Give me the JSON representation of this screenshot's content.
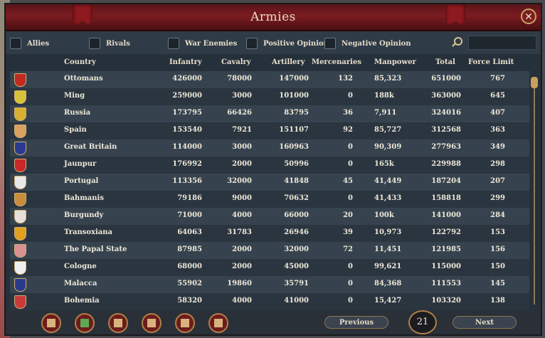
{
  "window": {
    "title": "Armies",
    "close_glyph": "✕"
  },
  "filters": [
    {
      "label": "Allies"
    },
    {
      "label": "Rivals"
    },
    {
      "label": "War Enemies"
    },
    {
      "label": "Positive Opinion"
    },
    {
      "label": "Negative Opinion"
    }
  ],
  "search": {
    "placeholder": ""
  },
  "columns": [
    "Country",
    "Infantry",
    "Cavalry",
    "Artillery",
    "Mercenaries",
    "Manpower",
    "Total",
    "Force Limit"
  ],
  "rows": [
    {
      "country": "Ottomans",
      "infantry": "426000",
      "cavalry": "78000",
      "artillery": "147000",
      "mercenaries": "132",
      "manpower": "85,323",
      "total": "651000",
      "force_limit": "767",
      "flag_color": "#c02a20"
    },
    {
      "country": "Ming",
      "infantry": "259000",
      "cavalry": "3000",
      "artillery": "101000",
      "mercenaries": "0",
      "manpower": "188k",
      "total": "363000",
      "force_limit": "645",
      "flag_color": "#d8c23a"
    },
    {
      "country": "Russia",
      "infantry": "173795",
      "cavalry": "66426",
      "artillery": "83795",
      "mercenaries": "36",
      "manpower": "7,911",
      "total": "324016",
      "force_limit": "407",
      "flag_color": "#d8b030"
    },
    {
      "country": "Spain",
      "infantry": "153540",
      "cavalry": "7921",
      "artillery": "151107",
      "mercenaries": "92",
      "manpower": "85,727",
      "total": "312568",
      "force_limit": "363",
      "flag_color": "#d9a060"
    },
    {
      "country": "Great Britain",
      "infantry": "114000",
      "cavalry": "3000",
      "artillery": "160963",
      "mercenaries": "0",
      "manpower": "90,309",
      "total": "277963",
      "force_limit": "349",
      "flag_color": "#2a3a90"
    },
    {
      "country": "Jaunpur",
      "infantry": "176992",
      "cavalry": "2000",
      "artillery": "50996",
      "mercenaries": "0",
      "manpower": "165k",
      "total": "229988",
      "force_limit": "298",
      "flag_color": "#c82828"
    },
    {
      "country": "Portugal",
      "infantry": "113356",
      "cavalry": "32000",
      "artillery": "41848",
      "mercenaries": "45",
      "manpower": "41,449",
      "total": "187204",
      "force_limit": "207",
      "flag_color": "#e8e8e8"
    },
    {
      "country": "Bahmanis",
      "infantry": "79186",
      "cavalry": "9000",
      "artillery": "70632",
      "mercenaries": "0",
      "manpower": "41,433",
      "total": "158818",
      "force_limit": "299",
      "flag_color": "#c88c3a"
    },
    {
      "country": "Burgundy",
      "infantry": "71000",
      "cavalry": "4000",
      "artillery": "66000",
      "mercenaries": "20",
      "manpower": "100k",
      "total": "141000",
      "force_limit": "284",
      "flag_color": "#e8e0d8"
    },
    {
      "country": "Transoxiana",
      "infantry": "64063",
      "cavalry": "31783",
      "artillery": "26946",
      "mercenaries": "39",
      "manpower": "10,973",
      "total": "122792",
      "force_limit": "153",
      "flag_color": "#e0a020"
    },
    {
      "country": "The Papal State",
      "infantry": "87985",
      "cavalry": "2000",
      "artillery": "32000",
      "mercenaries": "72",
      "manpower": "11,451",
      "total": "121985",
      "force_limit": "156",
      "flag_color": "#d89090"
    },
    {
      "country": "Cologne",
      "infantry": "68000",
      "cavalry": "2000",
      "artillery": "45000",
      "mercenaries": "0",
      "manpower": "99,621",
      "total": "115000",
      "force_limit": "150",
      "flag_color": "#f0f0f0"
    },
    {
      "country": "Malacca",
      "infantry": "55902",
      "cavalry": "19860",
      "artillery": "35791",
      "mercenaries": "0",
      "manpower": "84,368",
      "total": "111553",
      "force_limit": "145",
      "flag_color": "#2a3a8a"
    },
    {
      "country": "Bohemia",
      "infantry": "58320",
      "cavalry": "4000",
      "artillery": "41000",
      "mercenaries": "0",
      "manpower": "15,427",
      "total": "103320",
      "force_limit": "138",
      "flag_color": "#c83a3a"
    }
  ],
  "pagination": {
    "previous_label": "Previous",
    "next_label": "Next",
    "page": "21"
  },
  "bottom_buttons": [
    {
      "icon": "ledger-icon"
    },
    {
      "icon": "buildings-icon"
    },
    {
      "icon": "crossed-swords-icon"
    },
    {
      "icon": "scroll-icon"
    },
    {
      "icon": "shield-icon"
    },
    {
      "icon": "diplomacy-icon"
    }
  ],
  "colors": {
    "title_bar": "#7a1c20",
    "row_alt": "#36434f",
    "row": "#2a3540",
    "accent": "#b08048"
  }
}
